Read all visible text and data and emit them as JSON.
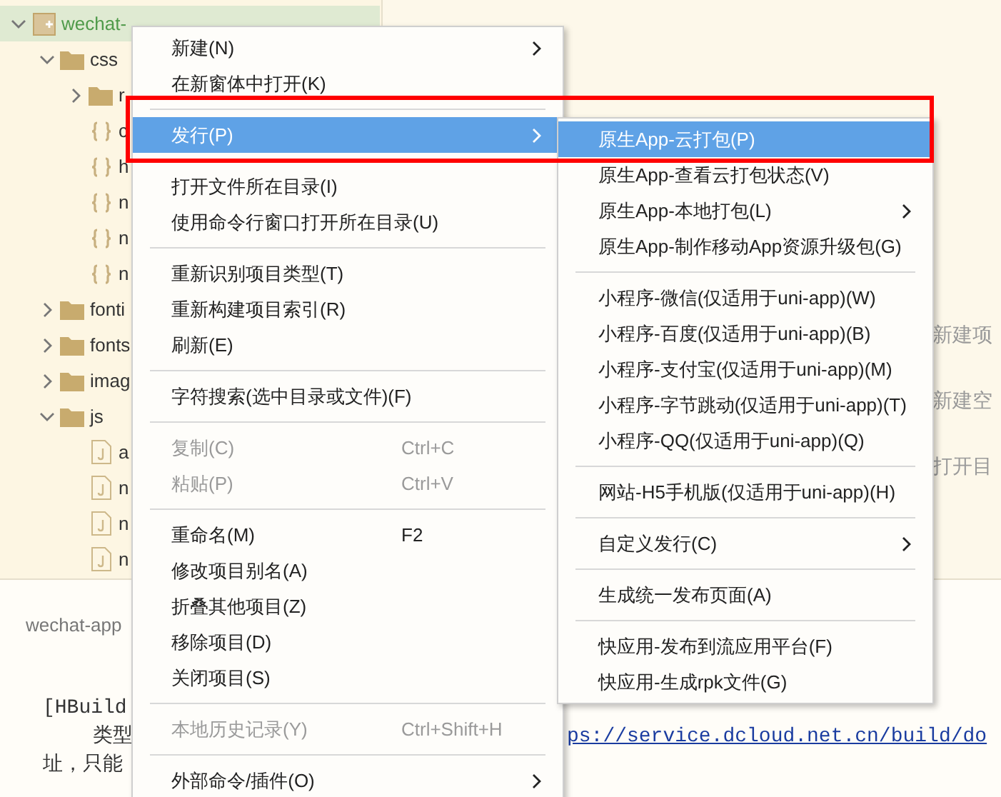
{
  "sidebar": {
    "tree": [
      {
        "label": "wechat-",
        "kind": "project",
        "expanded": true,
        "selected": true,
        "children": [
          {
            "label": "css",
            "kind": "folder",
            "expanded": true,
            "selected": false,
            "children": [
              {
                "label": "r",
                "kind": "folder",
                "expanded": false,
                "selected": false
              },
              {
                "label": "c",
                "kind": "style",
                "selected": false
              },
              {
                "label": "h",
                "kind": "style",
                "selected": false
              },
              {
                "label": "n",
                "kind": "style",
                "selected": false
              },
              {
                "label": "n",
                "kind": "style",
                "selected": false
              },
              {
                "label": "n",
                "kind": "style",
                "selected": false
              }
            ]
          },
          {
            "label": "fonti",
            "kind": "folder",
            "expanded": false,
            "selected": false
          },
          {
            "label": "fonts",
            "kind": "folder",
            "expanded": false,
            "selected": false
          },
          {
            "label": "imag",
            "kind": "folder",
            "expanded": false,
            "selected": false
          },
          {
            "label": "js",
            "kind": "folder",
            "expanded": true,
            "selected": false,
            "children": [
              {
                "label": "a",
                "kind": "script",
                "selected": false
              },
              {
                "label": "n",
                "kind": "script",
                "selected": false
              },
              {
                "label": "n",
                "kind": "script",
                "selected": false
              },
              {
                "label": "n",
                "kind": "script",
                "selected": false
              }
            ]
          }
        ]
      }
    ]
  },
  "editor": {
    "hints": [
      "新建项",
      "新建空",
      "打开目"
    ]
  },
  "console": {
    "tab": "wechat-app",
    "lines": [
      {
        "left": "[HBuild",
        "indent": false
      },
      {
        "left": "类型",
        "right": "ps://service.dcloud.net.cn/build/do",
        "indent": true,
        "link": true
      },
      {
        "left": "址，只能",
        "indent": false
      }
    ]
  },
  "context_menu": {
    "items": [
      {
        "kind": "item",
        "label": "新建(N)",
        "submenu": true,
        "selected": false,
        "disabled": false
      },
      {
        "kind": "item",
        "label": "在新窗体中打开(K)",
        "submenu": false,
        "selected": false,
        "disabled": false
      },
      {
        "kind": "separator"
      },
      {
        "kind": "item",
        "label": "发行(P)",
        "submenu": true,
        "selected": true,
        "disabled": false
      },
      {
        "kind": "separator"
      },
      {
        "kind": "item",
        "label": "打开文件所在目录(I)",
        "submenu": false,
        "selected": false,
        "disabled": false
      },
      {
        "kind": "item",
        "label": "使用命令行窗口打开所在目录(U)",
        "submenu": false,
        "selected": false,
        "disabled": false
      },
      {
        "kind": "separator"
      },
      {
        "kind": "item",
        "label": "重新识别项目类型(T)",
        "submenu": false,
        "selected": false,
        "disabled": false
      },
      {
        "kind": "item",
        "label": "重新构建项目索引(R)",
        "submenu": false,
        "selected": false,
        "disabled": false
      },
      {
        "kind": "item",
        "label": "刷新(E)",
        "submenu": false,
        "selected": false,
        "disabled": false
      },
      {
        "kind": "separator"
      },
      {
        "kind": "item",
        "label": "字符搜索(选中目录或文件)(F)",
        "submenu": false,
        "selected": false,
        "disabled": false
      },
      {
        "kind": "separator"
      },
      {
        "kind": "item",
        "label": "复制(C)",
        "shortcut": "Ctrl+C",
        "submenu": false,
        "selected": false,
        "disabled": true
      },
      {
        "kind": "item",
        "label": "粘贴(P)",
        "shortcut": "Ctrl+V",
        "submenu": false,
        "selected": false,
        "disabled": true
      },
      {
        "kind": "separator"
      },
      {
        "kind": "item",
        "label": "重命名(M)",
        "shortcut": "F2",
        "submenu": false,
        "selected": false,
        "disabled": false
      },
      {
        "kind": "item",
        "label": "修改项目别名(A)",
        "submenu": false,
        "selected": false,
        "disabled": false
      },
      {
        "kind": "item",
        "label": "折叠其他项目(Z)",
        "submenu": false,
        "selected": false,
        "disabled": false
      },
      {
        "kind": "item",
        "label": "移除项目(D)",
        "submenu": false,
        "selected": false,
        "disabled": false
      },
      {
        "kind": "item",
        "label": "关闭项目(S)",
        "submenu": false,
        "selected": false,
        "disabled": false
      },
      {
        "kind": "separator"
      },
      {
        "kind": "item",
        "label": "本地历史记录(Y)",
        "shortcut": "Ctrl+Shift+H",
        "submenu": false,
        "selected": false,
        "disabled": true
      },
      {
        "kind": "separator"
      },
      {
        "kind": "item",
        "label": "外部命令/插件(O)",
        "submenu": true,
        "selected": false,
        "disabled": false
      }
    ]
  },
  "submenu": {
    "items": [
      {
        "kind": "item",
        "label": "原生App-云打包(P)",
        "submenu": false,
        "selected": true
      },
      {
        "kind": "item",
        "label": "原生App-查看云打包状态(V)",
        "submenu": false,
        "selected": false
      },
      {
        "kind": "item",
        "label": "原生App-本地打包(L)",
        "submenu": true,
        "selected": false
      },
      {
        "kind": "item",
        "label": "原生App-制作移动App资源升级包(G)",
        "submenu": false,
        "selected": false
      },
      {
        "kind": "separator"
      },
      {
        "kind": "item",
        "label": "小程序-微信(仅适用于uni-app)(W)",
        "submenu": false,
        "selected": false
      },
      {
        "kind": "item",
        "label": "小程序-百度(仅适用于uni-app)(B)",
        "submenu": false,
        "selected": false
      },
      {
        "kind": "item",
        "label": "小程序-支付宝(仅适用于uni-app)(M)",
        "submenu": false,
        "selected": false
      },
      {
        "kind": "item",
        "label": "小程序-字节跳动(仅适用于uni-app)(T)",
        "submenu": false,
        "selected": false
      },
      {
        "kind": "item",
        "label": "小程序-QQ(仅适用于uni-app)(Q)",
        "submenu": false,
        "selected": false
      },
      {
        "kind": "separator"
      },
      {
        "kind": "item",
        "label": "网站-H5手机版(仅适用于uni-app)(H)",
        "submenu": false,
        "selected": false
      },
      {
        "kind": "separator"
      },
      {
        "kind": "item",
        "label": "自定义发行(C)",
        "submenu": true,
        "selected": false
      },
      {
        "kind": "separator"
      },
      {
        "kind": "item",
        "label": "生成统一发布页面(A)",
        "submenu": false,
        "selected": false
      },
      {
        "kind": "separator"
      },
      {
        "kind": "item",
        "label": "快应用-发布到流应用平台(F)",
        "submenu": false,
        "selected": false
      },
      {
        "kind": "item",
        "label": "快应用-生成rpk文件(G)",
        "submenu": false,
        "selected": false
      }
    ]
  },
  "highlight_frame": {
    "on": true
  }
}
